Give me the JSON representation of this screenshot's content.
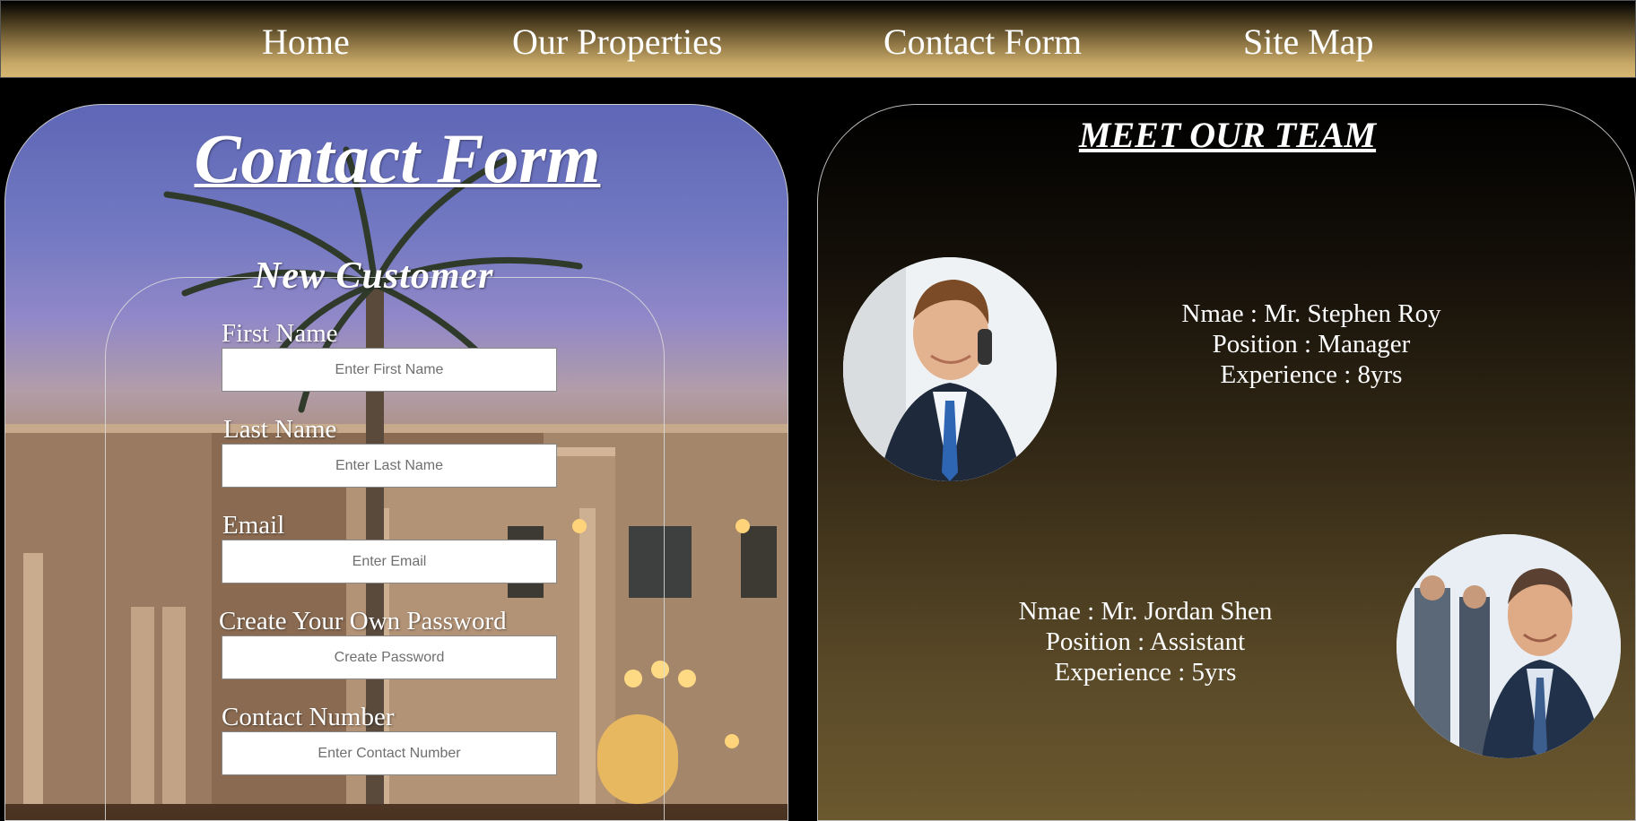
{
  "nav": {
    "home": "Home",
    "properties": "Our Properties",
    "contact": "Contact Form",
    "sitemap": "Site Map"
  },
  "form": {
    "title": "Contact Form",
    "section_title": "New Customer",
    "fields": {
      "first_name": {
        "label": "First Name",
        "placeholder": "Enter First Name"
      },
      "last_name": {
        "label": "Last Name",
        "placeholder": "Enter Last Name"
      },
      "email": {
        "label": "Email",
        "placeholder": "Enter Email"
      },
      "password": {
        "label": "Create Your Own Password",
        "placeholder": "Create Password"
      },
      "contact": {
        "label": "Contact Number",
        "placeholder": "Enter Contact Number"
      }
    }
  },
  "team": {
    "title": "MEET OUR TEAM",
    "members": [
      {
        "name": "Nmae : Mr. Stephen Roy",
        "position": "Position : Manager",
        "experience": "Experience : 8yrs"
      },
      {
        "name": "Nmae : Mr. Jordan Shen",
        "position": "Position : Assistant",
        "experience": "Experience : 5yrs"
      }
    ]
  },
  "colors": {
    "nav_gold": "#d7b873",
    "panel_brown": "#6b582f",
    "text": "#ffffff"
  }
}
